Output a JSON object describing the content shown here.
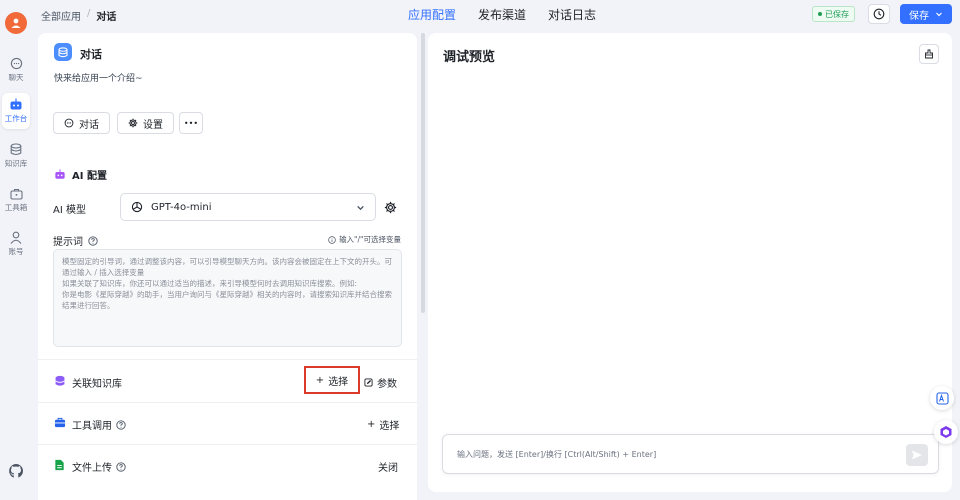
{
  "nav": {
    "items": [
      {
        "label": "聊天",
        "icon": "chat-bubble-icon"
      },
      {
        "label": "工作台",
        "icon": "robot-icon"
      },
      {
        "label": "知识库",
        "icon": "database-icon"
      },
      {
        "label": "工具箱",
        "icon": "toolbox-icon"
      },
      {
        "label": "账号",
        "icon": "user-icon"
      }
    ],
    "active": "工作台"
  },
  "breadcrumb": {
    "root": "全部应用",
    "sep": "/",
    "current": "对话"
  },
  "top_tabs": [
    {
      "label": "应用配置",
      "active": true
    },
    {
      "label": "发布渠道",
      "active": false
    },
    {
      "label": "对话日志",
      "active": false
    }
  ],
  "header": {
    "saved_status": "已保存",
    "save_label": "保存"
  },
  "app": {
    "name": "对话",
    "intro": "快来给应用一个介绍~",
    "buttons": {
      "chat": "对话",
      "settings": "设置",
      "more": "•••"
    }
  },
  "ai_config": {
    "title": "AI 配置",
    "model_label": "AI 模型",
    "model_value": "GPT-4o-mini",
    "prompt_label": "提示词",
    "prompt_hint": "输入\"/\"可选择变量",
    "prompt_placeholder": "模型固定的引导词，通过调整该内容，可以引导模型聊天方向。该内容会被固定在上下文的开头。可通过输入 / 插入选择变量\n如果关联了知识库，你还可以通过适当的描述，来引导模型何时去调用知识库搜索。例如:\n你是电影《星际穿越》的助手，当用户询问与《星际穿越》相关的内容时，请搜索知识库并结合搜索结果进行回答。"
  },
  "knowledge": {
    "label": "关联知识库",
    "select": "选择",
    "params": "参数"
  },
  "tools": {
    "label": "工具调用",
    "select": "选择"
  },
  "file_upload": {
    "label": "文件上传",
    "status": "关闭"
  },
  "preview": {
    "title": "调试预览",
    "input_placeholder": "输入问题，发送 [Enter]/换行 [Ctrl(Alt/Shift) + Enter]"
  },
  "colors": {
    "accent": "#3370ff",
    "highlight": "#d93a2b",
    "saved_green": "#1f9d55"
  }
}
